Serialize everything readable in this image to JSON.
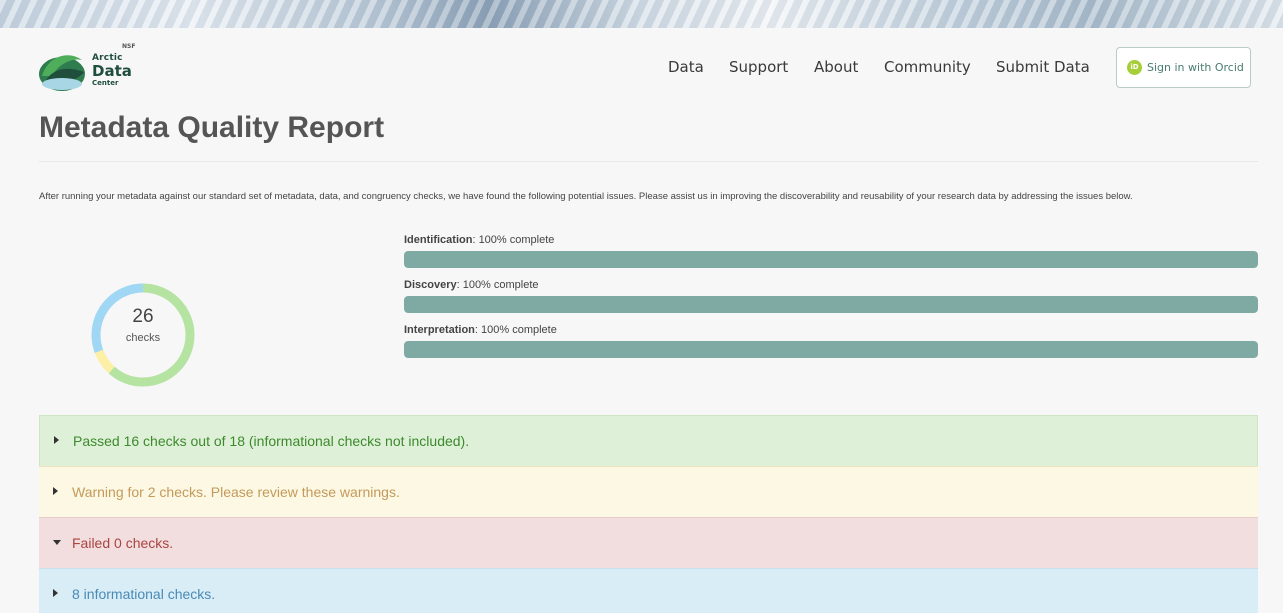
{
  "header": {
    "logo": {
      "small": "NSF",
      "line1": "Arctic",
      "line2": "Data",
      "line3": "Center"
    },
    "nav": [
      "Data",
      "Support",
      "About",
      "Community",
      "Submit Data"
    ],
    "signin": {
      "icon": "orcid-icon",
      "icon_text": "iD",
      "label": "Sign in with Orcid"
    }
  },
  "page": {
    "title": "Metadata Quality Report",
    "intro": "After running your metadata against our standard set of metadata, data, and congruency checks, we have found the following potential issues. Please assist us in improving the discoverability and reusability of your research data by addressing the issues below."
  },
  "summary": {
    "checks_count": "26",
    "checks_label": "checks",
    "donut_segments": [
      {
        "name": "passed",
        "value": 16,
        "color": "#b5e3a1"
      },
      {
        "name": "warning",
        "value": 2,
        "color": "#fcefa6"
      },
      {
        "name": "informational",
        "value": 8,
        "color": "#9fd7f5"
      }
    ]
  },
  "progress": [
    {
      "category": "Identification",
      "suffix": ": 100% complete",
      "percent": 100
    },
    {
      "category": "Discovery",
      "suffix": ": 100% complete",
      "percent": 100
    },
    {
      "category": "Interpretation",
      "suffix": ": 100% complete",
      "percent": 100
    }
  ],
  "panels": {
    "passed": "Passed 16 checks out of 18 (informational checks not included).",
    "warning": "Warning for 2 checks. Please review these warnings.",
    "failed": "Failed 0 checks.",
    "info": "8 informational checks."
  },
  "colors": {
    "progress_fill": "#7fa9a3",
    "passed_text": "#3c8a2c",
    "warning_text": "#c49a5a",
    "failed_text": "#a94442",
    "info_text": "#4a8ab5"
  }
}
